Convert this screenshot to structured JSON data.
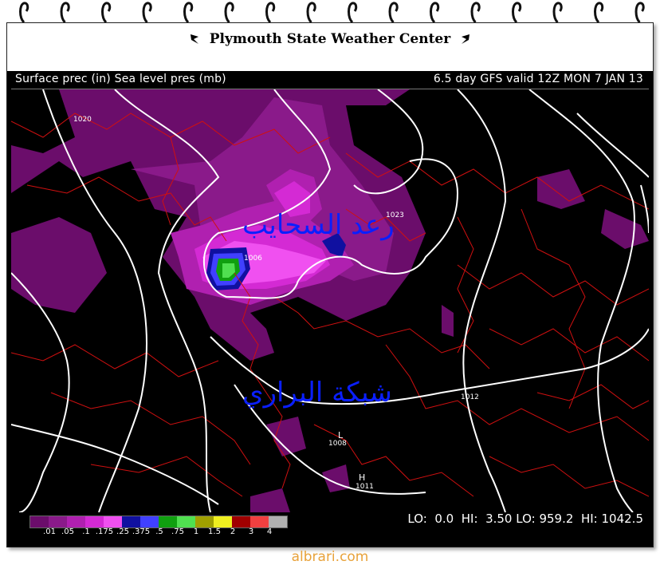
{
  "header": {
    "title": "Plymouth State Weather Center"
  },
  "subtitle": {
    "left": "Surface prec (in) Sea level pres (mb)",
    "right": "6.5 day GFS valid 12Z MON 7 JAN 13"
  },
  "map": {
    "overlay_text_top": "رعد السحايب",
    "overlay_text_bottom": "شبكة البراري",
    "pressure_labels": [
      "1020",
      "1023",
      "1006",
      "1012",
      "1008",
      "1011"
    ],
    "high_low_markers": [
      "L",
      "H"
    ]
  },
  "legend": {
    "ticks": [
      ".01",
      ".05",
      ".1",
      ".175",
      ".25",
      ".375",
      ".5",
      ".75",
      "1",
      "1.5",
      "2",
      "3",
      "4"
    ],
    "colors": [
      "#6b0d6b",
      "#8a1a8a",
      "#b020b0",
      "#d42ad4",
      "#f050f0",
      "#1010a0",
      "#4040ff",
      "#10a010",
      "#50e050",
      "#a0a000",
      "#f0f020",
      "#a00000",
      "#f04040",
      "#b0b0b0"
    ]
  },
  "stats": {
    "lo_label": "LO:",
    "lo_value": "0.0",
    "hi_label": "HI:",
    "hi_value": "3.50",
    "lo2_label": "LO:",
    "lo2_value": "959.2",
    "hi2_label": "HI:",
    "hi2_value": "1042.5"
  },
  "watermark": "albrari.com"
}
